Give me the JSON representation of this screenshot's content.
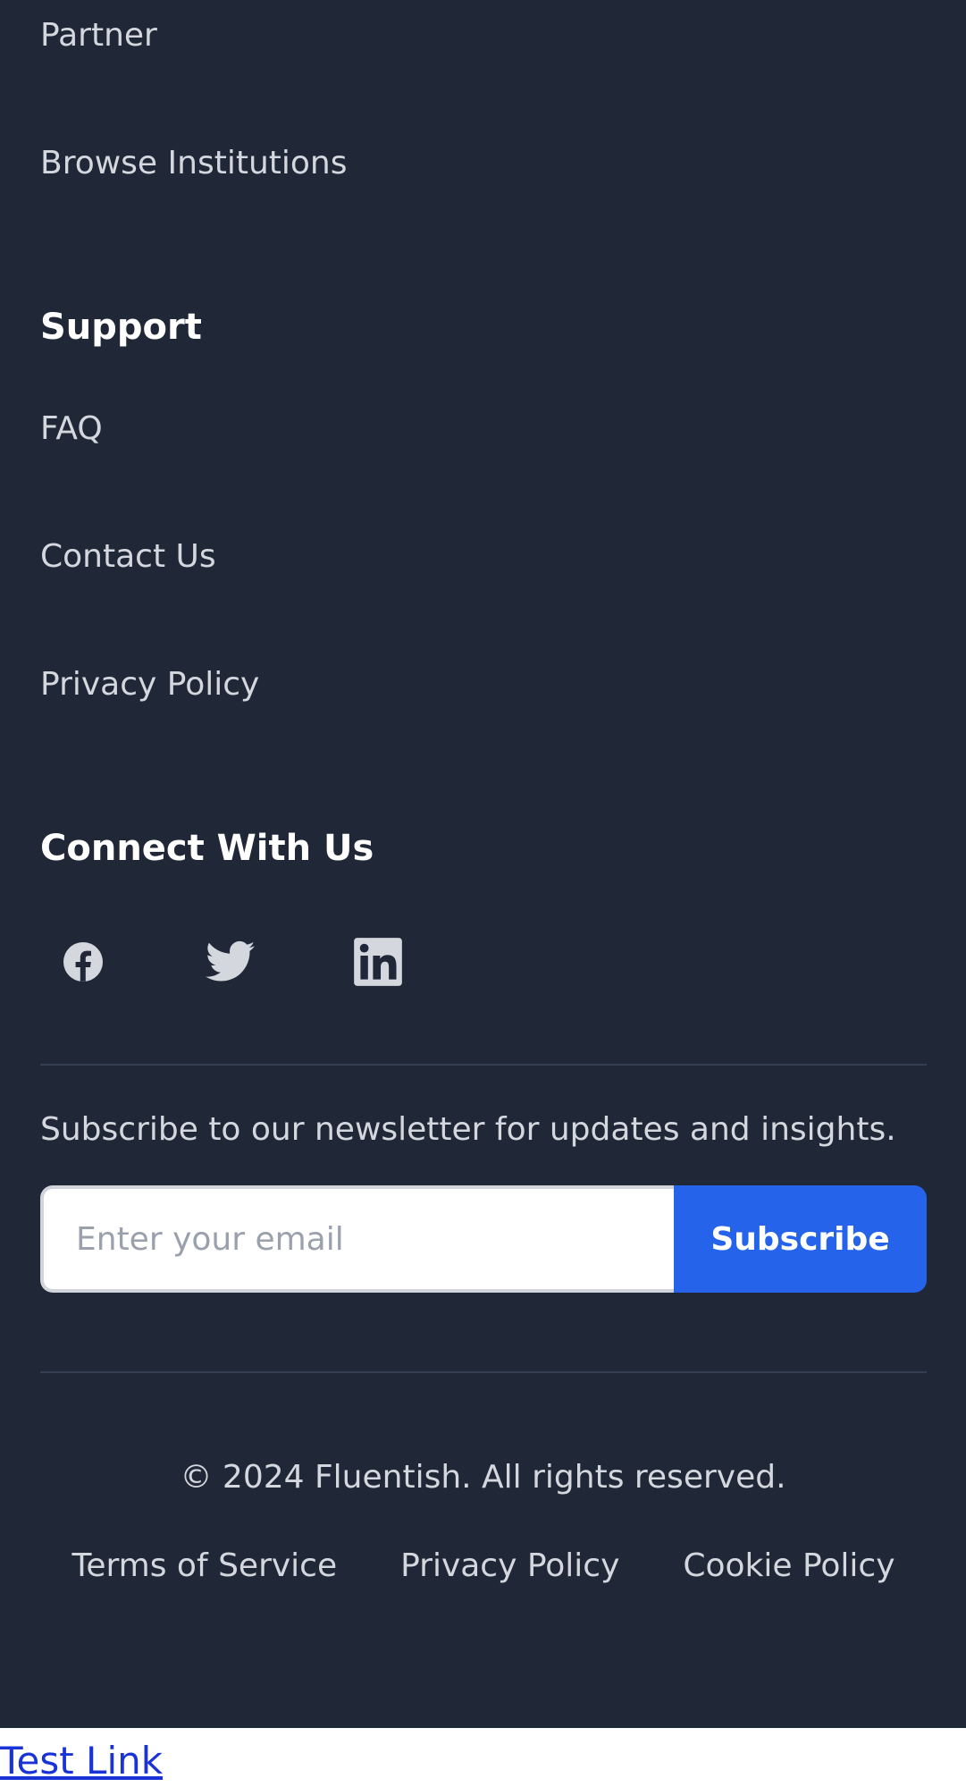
{
  "footer": {
    "explore_links": [
      {
        "label": "Partner"
      },
      {
        "label": "Browse Institutions"
      }
    ],
    "support": {
      "heading": "Support",
      "links": [
        {
          "label": "FAQ"
        },
        {
          "label": "Contact Us"
        },
        {
          "label": "Privacy Policy"
        }
      ]
    },
    "connect": {
      "heading": "Connect With Us",
      "icons": [
        "facebook-icon",
        "twitter-icon",
        "linkedin-icon"
      ]
    },
    "newsletter": {
      "text": "Subscribe to our newsletter for updates and insights.",
      "email_placeholder": "Enter your email",
      "email_value": "",
      "button_label": "Subscribe"
    },
    "copyright": "© 2024 Fluentish. All rights reserved.",
    "legal_links": [
      {
        "label": "Terms of Service"
      },
      {
        "label": "Privacy Policy"
      },
      {
        "label": "Cookie Policy"
      }
    ]
  },
  "test_link": "Test Link",
  "colors": {
    "footer_bg": "#202837",
    "text": "#d4d7dd",
    "heading": "#ffffff",
    "accent": "#2563eb",
    "divider": "#353f52",
    "test_link": "#1a33d6"
  }
}
